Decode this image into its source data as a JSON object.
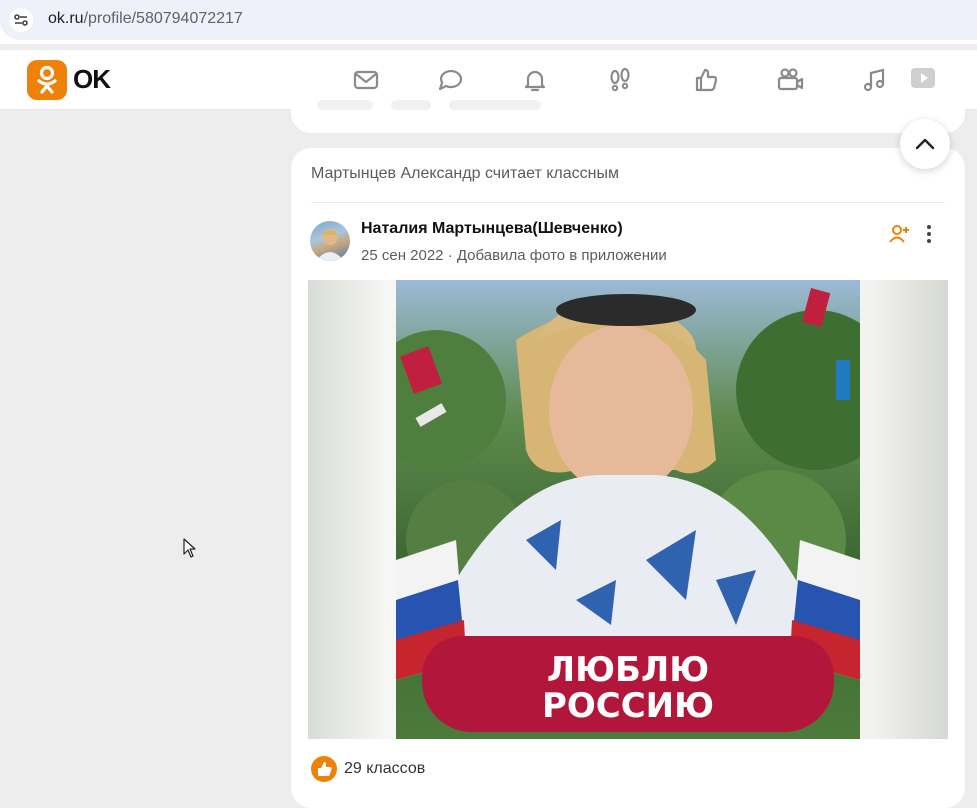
{
  "browser": {
    "url_host": "ok.ru",
    "url_path": "/profile/580794072217"
  },
  "header": {
    "logo_text": "OK",
    "brand_color": "#ee8208",
    "nav_icons": [
      "mail-icon",
      "chat-icon",
      "bell-icon",
      "footprints-icon",
      "thumbs-up-icon",
      "video-camera-icon",
      "music-icon",
      "video-play-icon"
    ]
  },
  "post": {
    "liked_by": "Мартынцев Александр считает классным",
    "author": "Наталия Мартынцева(Шевченко)",
    "date": "25 сен 2022",
    "separator": "·",
    "action": "Добавила фото в приложении",
    "photo_banner_line1": "ЛЮБЛЮ",
    "photo_banner_line2": "РОССИЮ",
    "likes_text": "29 классов"
  }
}
